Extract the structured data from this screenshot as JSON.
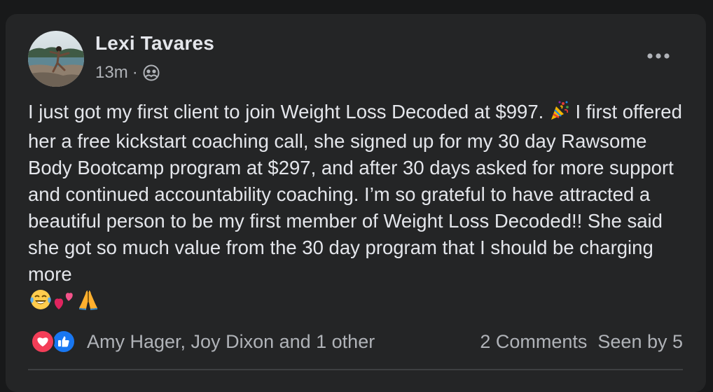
{
  "post": {
    "author_name": "Lexi Tavares",
    "timestamp": "13m",
    "separator": "·",
    "audience_icon": "friends-icon",
    "more_icon": "more-options-icon",
    "text_main": "I just got my first client to join Weight Loss Decoded at $997.",
    "text_rest": " I first offered her a free kickstart coaching call, she signed up for my 30 day Rawsome Body Bootcamp program at $297, and after 30 days asked for more support and continued accountability coaching. I’m so grateful to have attracted a beautiful person to be my first member of Weight Loss Decoded!! She said she got so much value from the 30 day program that I should be charging more",
    "emojis": [
      "party-popper-icon",
      "tears-of-joy-icon",
      "two-hearts-icon",
      "folded-hands-icon"
    ]
  },
  "engagement": {
    "reaction_icons": [
      "love-reaction-icon",
      "like-reaction-icon"
    ],
    "reactors_text": "Amy Hager, Joy Dixon and 1 other",
    "comments_text": "2 Comments",
    "seen_text": "Seen by 5"
  },
  "colors": {
    "page_background": "#18191a",
    "card_background": "#242526",
    "primary_text": "#e4e6eb",
    "secondary_text": "#b0b3b8",
    "love_red": "#f33e58",
    "like_blue": "#1877f2",
    "divider": "#3e4042"
  }
}
